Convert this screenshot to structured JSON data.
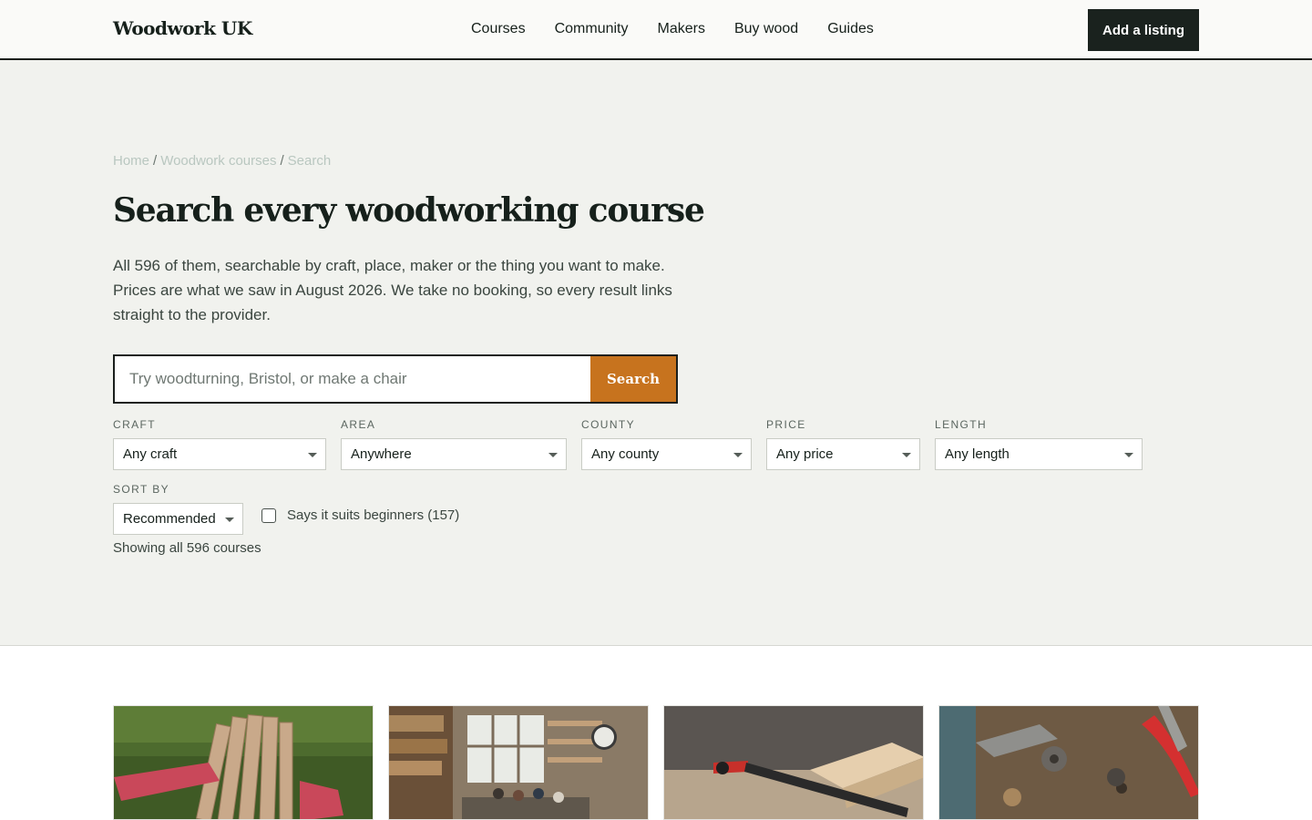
{
  "header": {
    "logo": "Woodwork UK",
    "nav": [
      "Courses",
      "Community",
      "Makers",
      "Buy wood",
      "Guides"
    ],
    "cta": "Add a listing"
  },
  "breadcrumb": [
    "Home",
    "Woodwork courses",
    "Search"
  ],
  "hero": {
    "title": "Search every woodworking course",
    "intro": "All 596 of them, searchable by craft, place, maker or the thing you want to make. Prices are what we saw in August 2026. We take no booking, so every result links straight to the provider."
  },
  "search": {
    "placeholder": "Try woodturning, Bristol, or make a chair",
    "button": "Search"
  },
  "filters": {
    "craft": {
      "label": "Craft",
      "value": "Any craft"
    },
    "area": {
      "label": "Area",
      "value": "Anywhere"
    },
    "county": {
      "label": "County",
      "value": "Any county"
    },
    "price": {
      "label": "Price",
      "value": "Any price"
    },
    "length": {
      "label": "Length",
      "value": "Any length"
    },
    "sort": {
      "label": "Sort by",
      "value": "Recommended"
    }
  },
  "beginner_filter": "Says it suits beginners (157)",
  "results_count": "Showing all 596 courses",
  "colors": {
    "accent": "#c7731e",
    "dark": "#1a221e",
    "hero_bg": "#f1f2ee"
  }
}
